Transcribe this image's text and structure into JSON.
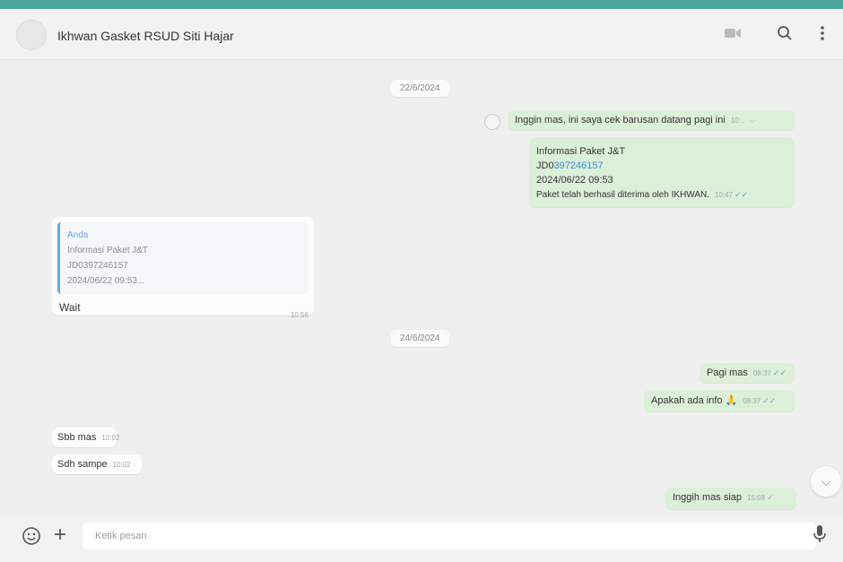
{
  "header": {
    "chat_title": "Ikhwan Gasket RSUD Siti Hajar",
    "icons": [
      "video-call-icon",
      "search-icon",
      "menu-icon"
    ]
  },
  "messages": {
    "date1": "22/6/2024",
    "out1_text": "Inggin mas, ini saya cek barusan datang pagi ini",
    "out1_time": "10:..",
    "out2_line1": "Informasi Paket J&T",
    "out2_prefix": "JD0",
    "out2_link": "397246157",
    "out2_line3": "2024/06/22 09:53",
    "out2_line4": "Paket telah berhasil diterima oleh IKHWAN.",
    "out2_time": "10:47",
    "reply_quote_author": "Anda",
    "reply_quote_line1": "Informasi Paket J&T",
    "reply_quote_line2": "JD0397246157",
    "reply_quote_line3": "2024/06/22 09:53...",
    "reply_text": "Wait",
    "reply_time": "10:56",
    "date2": "24/6/2024",
    "out3_text": "Pagi mas",
    "out3_time": "08:37",
    "out4_text": "Apakah ada info",
    "out4_emoji": "🙏",
    "out4_time": "08:37",
    "in1_text": "Sbb mas",
    "in1_time": "10:02",
    "in2_text": "Sdh sampe",
    "in2_time": "10:02",
    "out5_text": "Inggih mas siap",
    "out5_time": "15:08"
  },
  "composer": {
    "placeholder": "Ketik pesan",
    "icons": [
      "emoji-icon",
      "plus-icon",
      "microphone-icon"
    ]
  },
  "colors": {
    "accent": "#4ea79c",
    "outgoing_bubble": "#dcefd8",
    "incoming_bubble": "#fcfcfc",
    "chat_background": "#efefef",
    "read_tick": "#5ba3d9"
  }
}
